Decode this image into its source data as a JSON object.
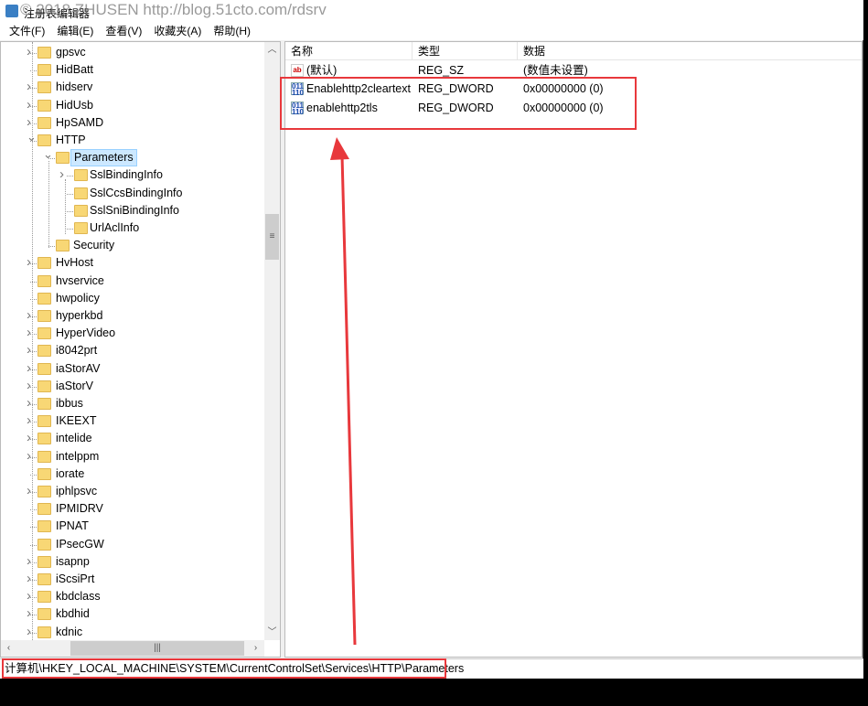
{
  "window": {
    "title": "注册表编辑器",
    "watermark": "© 2018 ZHUSEN http://blog.51cto.com/rdsrv"
  },
  "menu": [
    "文件(F)",
    "编辑(E)",
    "查看(V)",
    "收藏夹(A)",
    "帮助(H)"
  ],
  "tree": [
    {
      "label": "gpsvc",
      "level": 1,
      "expand": ">"
    },
    {
      "label": "HidBatt",
      "level": 1,
      "expand": ""
    },
    {
      "label": "hidserv",
      "level": 1,
      "expand": ">"
    },
    {
      "label": "HidUsb",
      "level": 1,
      "expand": ">"
    },
    {
      "label": "HpSAMD",
      "level": 1,
      "expand": ">"
    },
    {
      "label": "HTTP",
      "level": 1,
      "expand": "v"
    },
    {
      "label": "Parameters",
      "level": 2,
      "expand": "v",
      "selected": true
    },
    {
      "label": "SslBindingInfo",
      "level": 3,
      "expand": ">"
    },
    {
      "label": "SslCcsBindingInfo",
      "level": 3,
      "expand": ""
    },
    {
      "label": "SslSniBindingInfo",
      "level": 3,
      "expand": ""
    },
    {
      "label": "UrlAclInfo",
      "level": 3,
      "expand": ""
    },
    {
      "label": "Security",
      "level": 2,
      "expand": ""
    },
    {
      "label": "HvHost",
      "level": 1,
      "expand": ">"
    },
    {
      "label": "hvservice",
      "level": 1,
      "expand": ""
    },
    {
      "label": "hwpolicy",
      "level": 1,
      "expand": ""
    },
    {
      "label": "hyperkbd",
      "level": 1,
      "expand": ">"
    },
    {
      "label": "HyperVideo",
      "level": 1,
      "expand": ">"
    },
    {
      "label": "i8042prt",
      "level": 1,
      "expand": ">"
    },
    {
      "label": "iaStorAV",
      "level": 1,
      "expand": ">"
    },
    {
      "label": "iaStorV",
      "level": 1,
      "expand": ">"
    },
    {
      "label": "ibbus",
      "level": 1,
      "expand": ">"
    },
    {
      "label": "IKEEXT",
      "level": 1,
      "expand": ">"
    },
    {
      "label": "intelide",
      "level": 1,
      "expand": ">"
    },
    {
      "label": "intelppm",
      "level": 1,
      "expand": ">"
    },
    {
      "label": "iorate",
      "level": 1,
      "expand": ""
    },
    {
      "label": "iphlpsvc",
      "level": 1,
      "expand": ">"
    },
    {
      "label": "IPMIDRV",
      "level": 1,
      "expand": ""
    },
    {
      "label": "IPNAT",
      "level": 1,
      "expand": ""
    },
    {
      "label": "IPsecGW",
      "level": 1,
      "expand": ""
    },
    {
      "label": "isapnp",
      "level": 1,
      "expand": ">"
    },
    {
      "label": "iScsiPrt",
      "level": 1,
      "expand": ">"
    },
    {
      "label": "kbdclass",
      "level": 1,
      "expand": ">"
    },
    {
      "label": "kbdhid",
      "level": 1,
      "expand": ">"
    },
    {
      "label": "kdnic",
      "level": 1,
      "expand": ">"
    }
  ],
  "list": {
    "columns": [
      "名称",
      "类型",
      "数据"
    ],
    "rows": [
      {
        "icon": "string-value-icon",
        "name": "(默认)",
        "type": "REG_SZ",
        "data": "(数值未设置)"
      },
      {
        "icon": "dword-value-icon",
        "name": "Enablehttp2cleartext",
        "type": "REG_DWORD",
        "data": "0x00000000 (0)"
      },
      {
        "icon": "dword-value-icon",
        "name": "enablehttp2tls",
        "type": "REG_DWORD",
        "data": "0x00000000 (0)"
      }
    ]
  },
  "status": {
    "path": "计算机\\HKEY_LOCAL_MACHINE\\SYSTEM\\CurrentControlSet\\Services\\HTTP\\Parameters"
  },
  "annotation_color": "#e8383c"
}
